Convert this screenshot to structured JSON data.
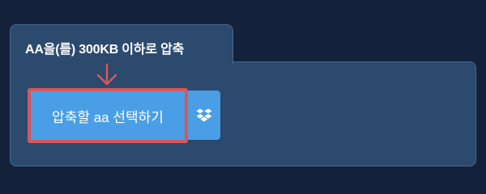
{
  "compress_panel": {
    "tab_title": "AA을(를) 300KB 이하로 압축",
    "select_button_label": "압축할 aa 선택하기",
    "dropbox_icon": "dropbox-icon",
    "arrow_icon": "arrow-down-icon"
  },
  "colors": {
    "background": "#13223a",
    "panel": "#2b4a6e",
    "panel_border": "#47678d",
    "button": "#4a9ee6",
    "highlight": "#d9565b"
  }
}
